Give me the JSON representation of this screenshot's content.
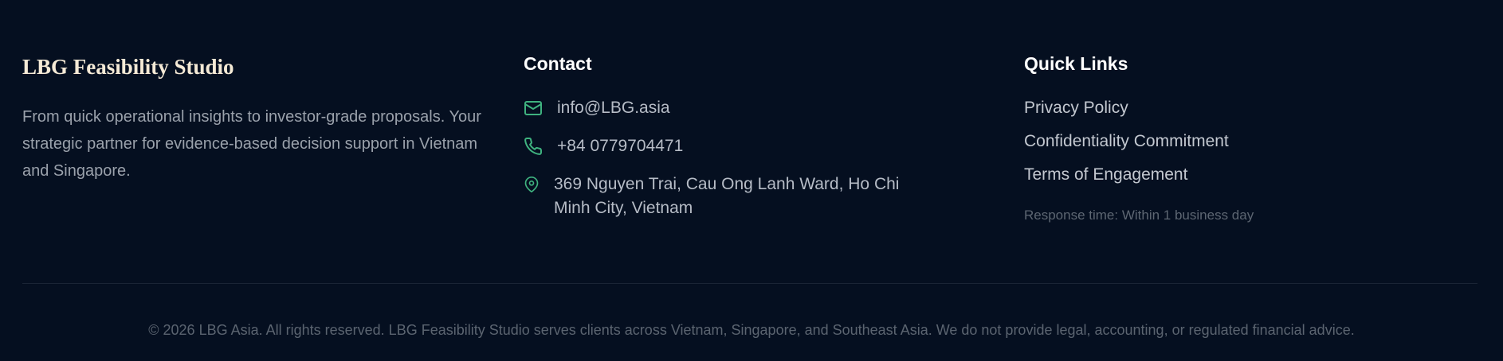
{
  "brand": {
    "title": "LBG Feasibility Studio",
    "description": "From quick operational insights to investor-grade proposals. Your strategic partner for evidence-based decision support in Vietnam and Singapore."
  },
  "contact": {
    "heading": "Contact",
    "email": "info@LBG.asia",
    "phone": "+84 0779704471",
    "address": "369 Nguyen Trai, Cau Ong Lanh Ward, Ho Chi Minh City, Vietnam",
    "icon_color": "#3fb27f",
    "icons": [
      "mail-icon",
      "phone-icon",
      "map-pin-icon"
    ]
  },
  "quick_links": {
    "heading": "Quick Links",
    "items": [
      {
        "label": "Privacy Policy"
      },
      {
        "label": "Confidentiality Commitment"
      },
      {
        "label": "Terms of Engagement"
      }
    ],
    "response_time": "Response time: Within 1 business day"
  },
  "footer": {
    "copyright": "© 2026 LBG Asia. All rights reserved. LBG Feasibility Studio serves clients across Vietnam, Singapore, and Southeast Asia. We do not provide legal, accounting, or regulated financial advice."
  },
  "colors": {
    "background": "#050f20",
    "brand_title": "#f5ead6",
    "accent": "#3fb27f"
  }
}
